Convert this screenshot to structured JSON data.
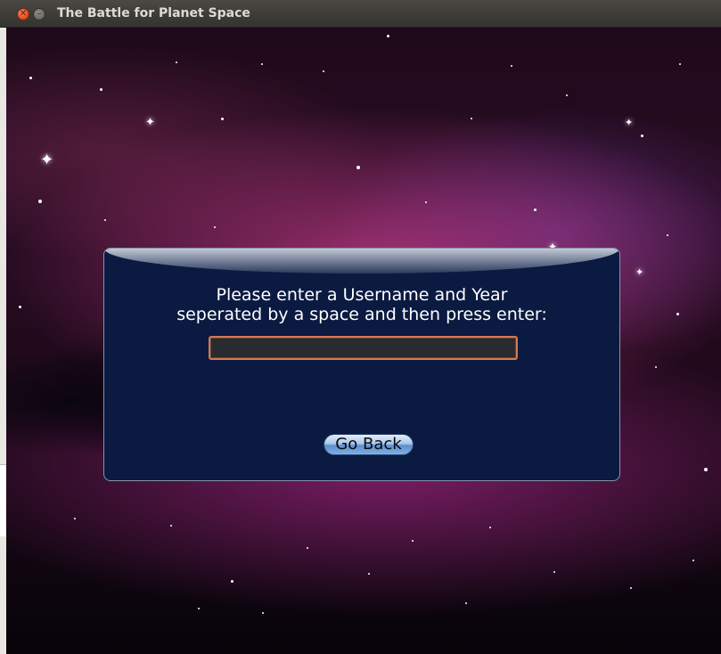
{
  "window": {
    "title": "The Battle for Planet Space",
    "close_icon": "close-icon",
    "minimize_icon": "minimize-icon"
  },
  "dialog": {
    "prompt_line1": "Please enter a Username and Year",
    "prompt_line2": "seperated by a space and then press enter:",
    "input_value": "",
    "go_back_label": "Go Back"
  }
}
